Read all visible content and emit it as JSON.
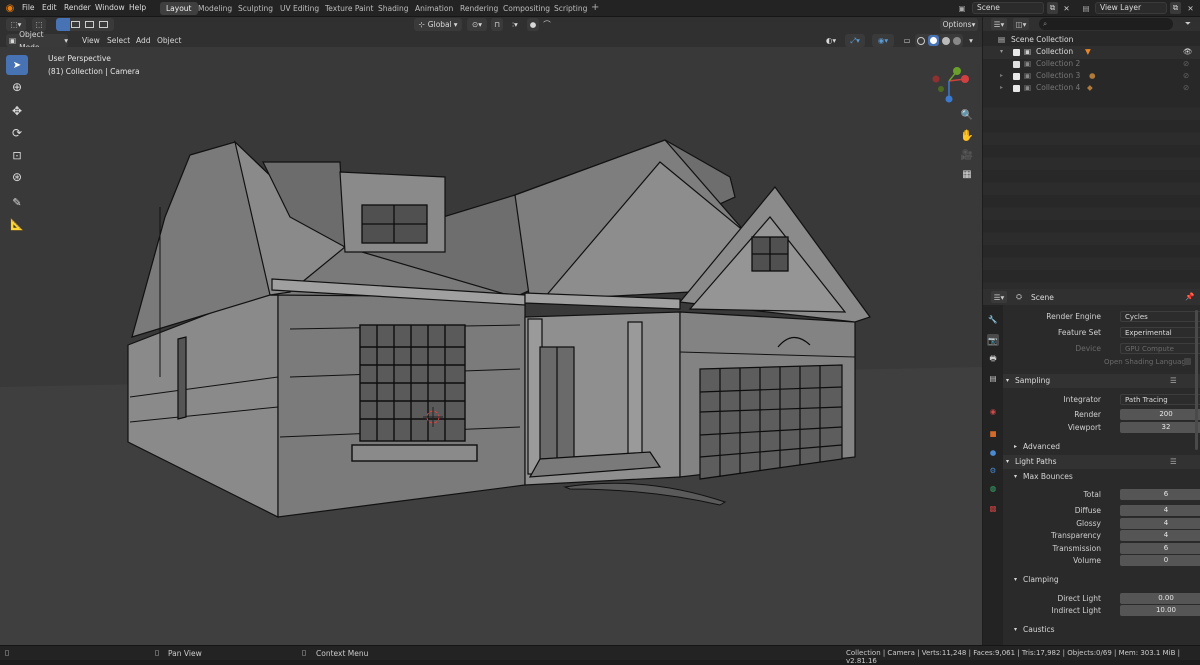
{
  "top_menu": [
    "File",
    "Edit",
    "Render",
    "Window",
    "Help"
  ],
  "workspaces": [
    "Layout",
    "Modeling",
    "Sculpting",
    "UV Editing",
    "Texture Paint",
    "Shading",
    "Animation",
    "Rendering",
    "Compositing",
    "Scripting"
  ],
  "scene_name": "Scene",
  "view_layer": "View Layer",
  "viewport_header": {
    "mode": "Object Mode",
    "menus": [
      "View",
      "Select",
      "Add",
      "Object"
    ],
    "orientation": "Global",
    "options": "Options"
  },
  "viewport": {
    "perspective": "User Perspective",
    "info": "(81) Collection | Camera"
  },
  "outliner": {
    "root": "Scene Collection",
    "items": [
      "Collection",
      "Collection 2",
      "Collection 3",
      "Collection 4"
    ]
  },
  "properties": {
    "context": "Scene",
    "render_engine_label": "Render Engine",
    "render_engine": "Cycles",
    "feature_set_label": "Feature Set",
    "feature_set": "Experimental",
    "device_label": "Device",
    "device": "GPU Compute",
    "osl_label": "Open Shading Language",
    "sampling": "Sampling",
    "integrator_label": "Integrator",
    "integrator": "Path Tracing",
    "render_label": "Render",
    "render_samples": "200",
    "viewport_label": "Viewport",
    "viewport_samples": "32",
    "advanced": "Advanced",
    "light_paths": "Light Paths",
    "max_bounces": "Max Bounces",
    "bounces": [
      {
        "label": "Total",
        "value": "6"
      },
      {
        "label": "Diffuse",
        "value": "4"
      },
      {
        "label": "Glossy",
        "value": "4"
      },
      {
        "label": "Transparency",
        "value": "4"
      },
      {
        "label": "Transmission",
        "value": "6"
      },
      {
        "label": "Volume",
        "value": "0"
      }
    ],
    "clamping": "Clamping",
    "direct_light_label": "Direct Light",
    "direct_light": "0.00",
    "indirect_light_label": "Indirect Light",
    "indirect_light": "10.00",
    "caustics": "Caustics"
  },
  "status": {
    "pan": "Pan View",
    "context": "Context Menu",
    "info": "Collection | Camera | Verts:11,248 | Faces:9,061 | Tris:17,982 | Objects:0/69 | Mem: 303.1 MiB | v2.81.16"
  },
  "colors": {
    "accent": "#4772b3",
    "viewport_bg": "#393939",
    "panel_bg": "#2a2a2a"
  }
}
